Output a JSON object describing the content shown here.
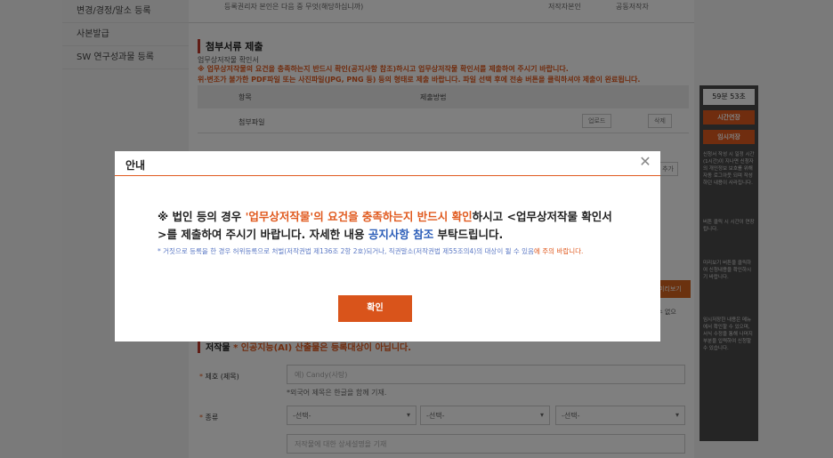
{
  "sidebar": {
    "items": [
      {
        "label": "변경/경정/말소 등록"
      },
      {
        "label": "사본발급"
      },
      {
        "label": "SW 연구성과물 등록"
      }
    ]
  },
  "top_strip": {
    "text": "등록권리자 본인은 다음 중 무엇(해당하십니까)",
    "radio1": "저작자본인",
    "radio2": "공동저작자"
  },
  "attachments": {
    "title": "첨부서류 제출",
    "subtitle": "업무상저작물 확인서",
    "warning1": "※ 업무상저작물의 요건을 충족하는지 반드시 확인(공지사항 참조)하시고 업무상저작물 확인서를 제출하여 주시기 바랍니다.",
    "warning2": "위·변조가 불가한 PDF파일 또는 사진파일(JPG, PNG 등) 등의 형태로 제출 바랍니다. 파일 선택 후에 전송 버튼을 클릭하셔야 제출이 완료됩니다.",
    "col_item": "항목",
    "col_method": "제출방법",
    "row_label": "첨부파일",
    "upload_btn": "업로드",
    "delete_btn": "삭제",
    "add_btn": "파일 추가"
  },
  "ghost": {
    "preview_btn": "등록정보 미리보기",
    "notice_tail": "시 변경할 수 없으"
  },
  "work_section": {
    "title": "저작물",
    "warning": "* 인공지능(AI) 산출물은 등록대상이 아닙니다.",
    "title_label": "제호 (제목)",
    "title_placeholder": "예) Candy(사탕)",
    "title_hint": "*외국어 제목은 한글을 함께 기재.",
    "kind_label": "종류",
    "kind_select1": "-선택-",
    "kind_select2": "-선택-",
    "kind_select3": "-선택-",
    "desc_placeholder": "저작물에 대한 상세설명을 기재"
  },
  "right_panel": {
    "timer": "59분 53초",
    "extend_btn": "시간연장",
    "save_btn": "임시저장",
    "note1": "신청서 작성 시 일정 시간(1시간)이 지나면 신청자의 개인정보 보호를 위해 자동 로그아웃 되며 작성하던 내용이 사라집니다.",
    "note2": "버튼 클릭 시 시간이 연장됩니다.",
    "note3": "미리보기 버튼을 클릭하여 신청내용을 확인하시기 바랍니다.",
    "note4": "임시저장한 내용은 메뉴에서 확인할 수 있으며, 서식 수정을 통해 나머지 부분을 입력하여 신청할 수 있습니다."
  },
  "modal": {
    "title": "안내",
    "close_icon": "close-icon",
    "msg_prefix": "※ 법인 등의 경우 ",
    "msg_highlight": "'업무상저작물'의 요건을 충족하는지 반드시 확인",
    "msg_middle": "하시고 <업무상저작물 확인서>를 제출하여 주시기 바랍니다. 자세한 내용 ",
    "msg_link": "공지사항 참조",
    "msg_suffix": " 부탁드립니다.",
    "note_main": "* 거짓으로 등록을 한 경우 허위등록으로 처벌(저작권법 제136조 2항 2호)되거나, 직권말소(저작권법 제55조의4)의 대상이 될 수 있음",
    "note_red": "에 주의 바랍니다.",
    "ok_button": "확인"
  },
  "colors": {
    "accent": "#e05a1f",
    "link": "#2b5db8",
    "overlay": "rgba(0,0,0,0.5)"
  }
}
